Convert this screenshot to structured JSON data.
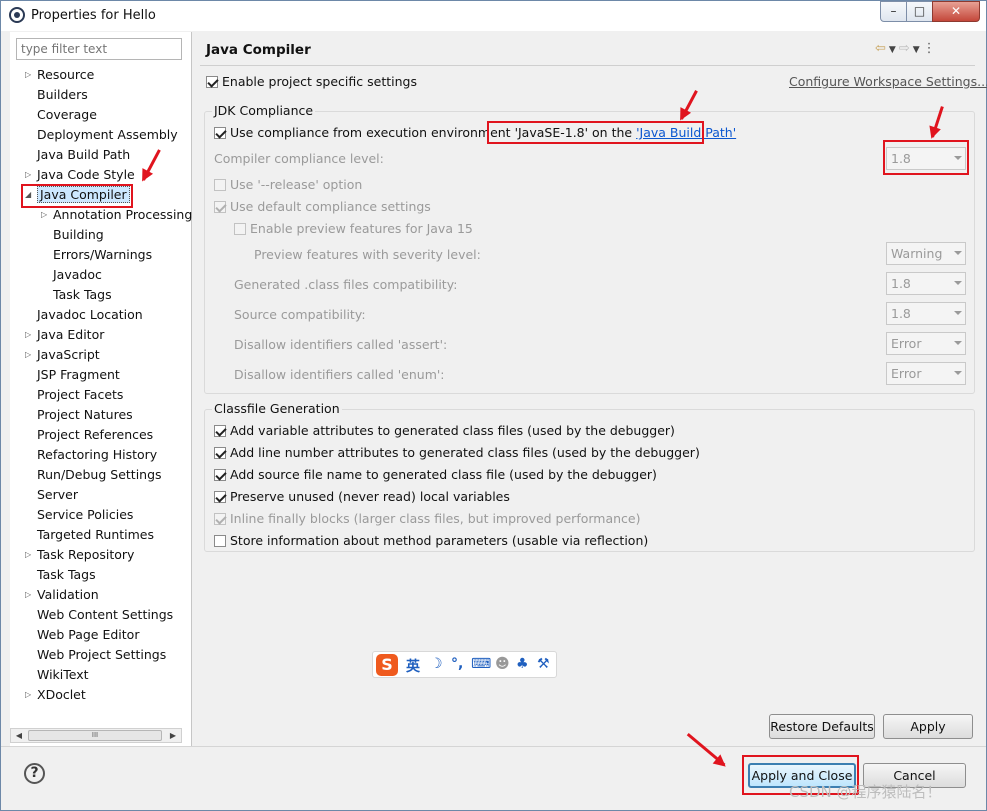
{
  "window": {
    "title": "Properties for Hello",
    "min_glyph": "–",
    "max_glyph": "□",
    "close_glyph": "✕"
  },
  "filter": {
    "placeholder": "type filter text"
  },
  "tree": {
    "items": [
      {
        "label": "Resource",
        "indent": 0,
        "expandable": true
      },
      {
        "label": "Builders",
        "indent": 0,
        "expandable": false
      },
      {
        "label": "Coverage",
        "indent": 0,
        "expandable": false
      },
      {
        "label": "Deployment Assembly",
        "indent": 0,
        "expandable": false
      },
      {
        "label": "Java Build Path",
        "indent": 0,
        "expandable": false
      },
      {
        "label": "Java Code Style",
        "indent": 0,
        "expandable": true
      },
      {
        "label": "Java Compiler",
        "indent": 0,
        "expandable": true,
        "expanded": true,
        "selected": true
      },
      {
        "label": "Annotation Processing",
        "indent": 1,
        "expandable": true
      },
      {
        "label": "Building",
        "indent": 1,
        "expandable": false
      },
      {
        "label": "Errors/Warnings",
        "indent": 1,
        "expandable": false
      },
      {
        "label": "Javadoc",
        "indent": 1,
        "expandable": false
      },
      {
        "label": "Task Tags",
        "indent": 1,
        "expandable": false
      },
      {
        "label": "Javadoc Location",
        "indent": 0,
        "expandable": false
      },
      {
        "label": "Java Editor",
        "indent": 0,
        "expandable": true
      },
      {
        "label": "JavaScript",
        "indent": 0,
        "expandable": true
      },
      {
        "label": "JSP Fragment",
        "indent": 0,
        "expandable": false
      },
      {
        "label": "Project Facets",
        "indent": 0,
        "expandable": false
      },
      {
        "label": "Project Natures",
        "indent": 0,
        "expandable": false
      },
      {
        "label": "Project References",
        "indent": 0,
        "expandable": false
      },
      {
        "label": "Refactoring History",
        "indent": 0,
        "expandable": false
      },
      {
        "label": "Run/Debug Settings",
        "indent": 0,
        "expandable": false
      },
      {
        "label": "Server",
        "indent": 0,
        "expandable": false
      },
      {
        "label": "Service Policies",
        "indent": 0,
        "expandable": false
      },
      {
        "label": "Targeted Runtimes",
        "indent": 0,
        "expandable": false
      },
      {
        "label": "Task Repository",
        "indent": 0,
        "expandable": true
      },
      {
        "label": "Task Tags",
        "indent": 0,
        "expandable": false
      },
      {
        "label": "Validation",
        "indent": 0,
        "expandable": true
      },
      {
        "label": "Web Content Settings",
        "indent": 0,
        "expandable": false
      },
      {
        "label": "Web Page Editor",
        "indent": 0,
        "expandable": false
      },
      {
        "label": "Web Project Settings",
        "indent": 0,
        "expandable": false
      },
      {
        "label": "WikiText",
        "indent": 0,
        "expandable": false
      },
      {
        "label": "XDoclet",
        "indent": 0,
        "expandable": true
      }
    ],
    "scroll_glyph": "III"
  },
  "page": {
    "title": "Java Compiler",
    "enable_specific": "Enable project specific settings",
    "configure_link": "Configure Workspace Settings...",
    "jdk": {
      "group_title": "JDK Compliance",
      "use_compliance": "Use compliance from execution environment ",
      "env_name": "'JavaSE-1.8'",
      "on_the": " on the ",
      "build_path_link": "'Java Build Path'",
      "compliance_level_label": "Compiler compliance level:",
      "compliance_level_value": "1.8",
      "release_option": "Use '--release' option",
      "default_compliance": "Use default compliance settings",
      "enable_preview": "Enable preview features for Java 15",
      "preview_severity_label": "Preview features with severity level:",
      "preview_severity_value": "Warning",
      "class_compat_label": "Generated .class files compatibility:",
      "class_compat_value": "1.8",
      "source_compat_label": "Source compatibility:",
      "source_compat_value": "1.8",
      "assert_label": "Disallow identifiers called 'assert':",
      "assert_value": "Error",
      "enum_label": "Disallow identifiers called 'enum':",
      "enum_value": "Error"
    },
    "classfile": {
      "group_title": "Classfile Generation",
      "opt1": "Add variable attributes to generated class files (used by the debugger)",
      "opt2": "Add line number attributes to generated class files (used by the debugger)",
      "opt3": "Add source file name to generated class file (used by the debugger)",
      "opt4": "Preserve unused (never read) local variables",
      "opt5": "Inline finally blocks (larger class files, but improved performance)",
      "opt6": "Store information about method parameters (usable via reflection)"
    },
    "restore_defaults": "Restore Defaults",
    "apply": "Apply"
  },
  "footer": {
    "help": "?",
    "apply_close": "Apply and Close",
    "cancel": "Cancel"
  },
  "ime": {
    "logo": "S",
    "lang": "英",
    "moon": "☽",
    "punct": "°,",
    "keyboard": "⌨",
    "user": "☻",
    "shirt": "♣",
    "wrench": "⚒"
  },
  "watermark": "CSDN @程序猿陆名！",
  "colors": {
    "annotation_red": "#e0141e",
    "link_blue": "#0b57d0"
  }
}
